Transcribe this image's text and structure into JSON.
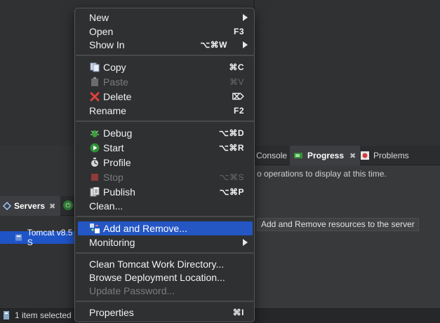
{
  "background": {
    "right_tabs": [
      {
        "label": "Console",
        "icon": "console-icon"
      },
      {
        "label": "Progress",
        "icon": "progress-icon"
      },
      {
        "label": "Problems",
        "icon": "problems-icon"
      }
    ],
    "progress_message": "o operations to display at this time.",
    "servers_tab_label": "Servers",
    "tomcat_label": "Tomcat v8.5 S",
    "status_text": "1 item selected"
  },
  "tooltip": "Add and Remove resources to the server",
  "menu": {
    "items": [
      {
        "label": "New",
        "shortcut": "",
        "submenu": true
      },
      {
        "label": "Open",
        "shortcut": "F3"
      },
      {
        "label": "Show In",
        "shortcut": "⌥⌘W",
        "submenu": true
      },
      {
        "label": "Copy",
        "shortcut": "⌘C",
        "icon": "copy-icon"
      },
      {
        "label": "Paste",
        "shortcut": "⌘V",
        "icon": "paste-icon",
        "disabled": true
      },
      {
        "label": "Delete",
        "shortcut": "⌦",
        "icon": "delete-icon"
      },
      {
        "label": "Rename",
        "shortcut": "F2"
      },
      {
        "label": "Debug",
        "shortcut": "⌥⌘D",
        "icon": "debug-icon"
      },
      {
        "label": "Start",
        "shortcut": "⌥⌘R",
        "icon": "start-icon"
      },
      {
        "label": "Profile",
        "shortcut": "",
        "icon": "profile-icon"
      },
      {
        "label": "Stop",
        "shortcut": "⌥⌘S",
        "icon": "stop-icon",
        "disabled": true
      },
      {
        "label": "Publish",
        "shortcut": "⌥⌘P",
        "icon": "publish-icon"
      },
      {
        "label": "Clean...",
        "shortcut": ""
      },
      {
        "label": "Add and Remove...",
        "shortcut": "",
        "icon": "add-remove-icon",
        "highlighted": true
      },
      {
        "label": "Monitoring",
        "shortcut": "",
        "submenu": true
      },
      {
        "label": "Clean Tomcat Work Directory...",
        "shortcut": ""
      },
      {
        "label": "Browse Deployment Location...",
        "shortcut": ""
      },
      {
        "label": "Update Password...",
        "shortcut": "",
        "disabled": true
      },
      {
        "label": "Properties",
        "shortcut": "⌘I"
      }
    ]
  },
  "colors": {
    "highlight": "#2456c4",
    "selection": "#1f54c7",
    "menu_bg": "#2f3032"
  }
}
